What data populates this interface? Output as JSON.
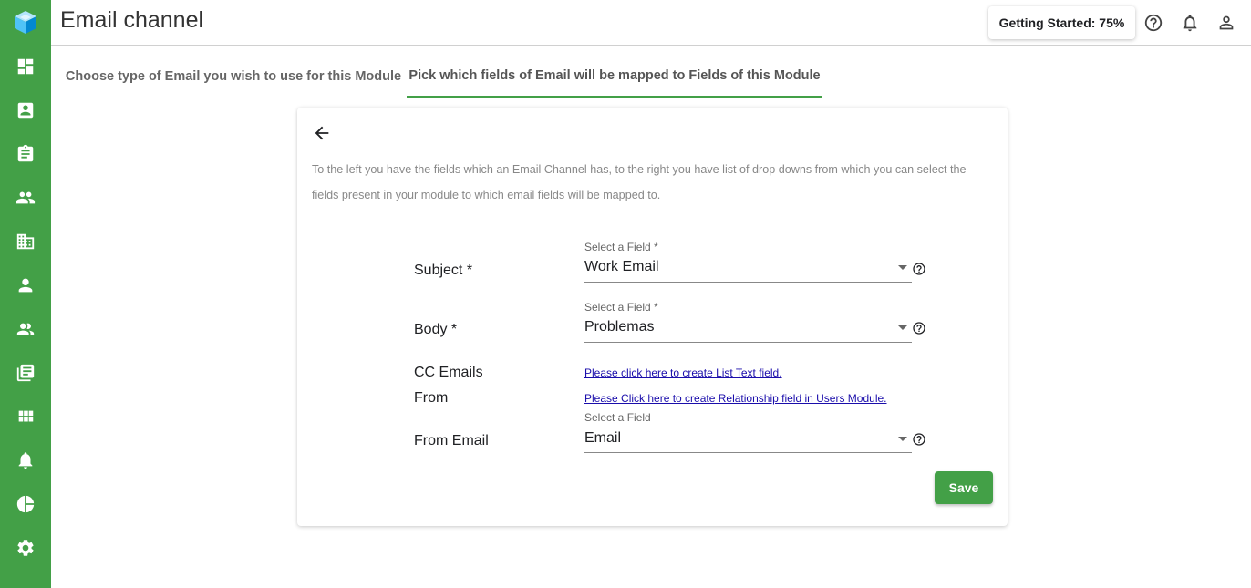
{
  "header": {
    "title": "Email channel",
    "getting_started": "Getting Started: 75%"
  },
  "sidebar": {
    "items": [
      {
        "icon": "dashboard-icon"
      },
      {
        "icon": "contact-card-icon"
      },
      {
        "icon": "clipboard-icon"
      },
      {
        "icon": "group-icon"
      },
      {
        "icon": "business-icon"
      },
      {
        "icon": "person-icon"
      },
      {
        "icon": "people-icon"
      },
      {
        "icon": "library-icon"
      },
      {
        "icon": "apps-icon"
      },
      {
        "icon": "bell-icon"
      },
      {
        "icon": "pie-chart-icon"
      },
      {
        "icon": "settings-icon"
      }
    ]
  },
  "tabs": [
    {
      "label": "Choose type of Email you wish to use for this Module"
    },
    {
      "label": "Pick which fields of Email will be mapped to Fields of this Module"
    }
  ],
  "description": "To the left you have the fields which an Email Channel has, to the right you have list of drop downs from which you can select the fields present in your module to which email fields will be mapped to.",
  "mappings": {
    "subject": {
      "label": "Subject *",
      "caption": "Select a Field *",
      "value": "Work Email"
    },
    "body": {
      "label": "Body *",
      "caption": "Select a Field *",
      "value": "Problemas"
    },
    "cc_emails": {
      "label": "CC Emails",
      "link": "Please click here to create List Text field."
    },
    "from": {
      "label": "From",
      "link": "Please Click here to create Relationship field in Users Module."
    },
    "from_email": {
      "label": "From Email",
      "caption": "Select a Field",
      "value": "Email"
    }
  },
  "actions": {
    "save": "Save"
  },
  "colors": {
    "brand": "#43a047",
    "link": "#1a0dab"
  }
}
